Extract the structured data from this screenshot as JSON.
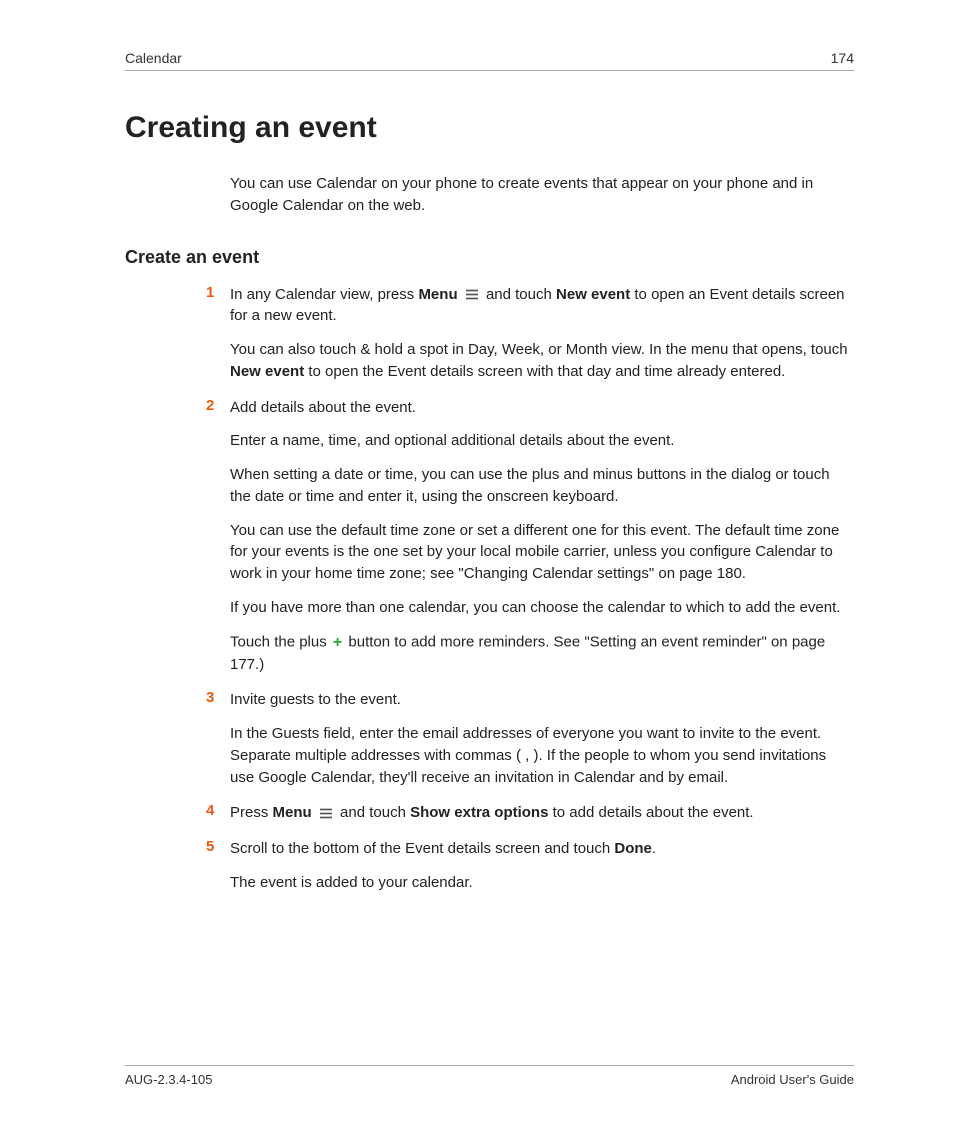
{
  "header": {
    "section": "Calendar",
    "page_number": "174"
  },
  "title": "Creating an event",
  "intro": "You can use Calendar on your phone to create events that appear on your phone and in Google Calendar on the web.",
  "subhead": "Create an event",
  "steps": {
    "s1": {
      "num": "1",
      "p1a": "In any Calendar view, press ",
      "p1b": "Menu",
      "p1c": " and touch ",
      "p1d": "New event",
      "p1e": " to open an Event details screen for a new event.",
      "p2a": "You can also touch & hold a spot in Day, Week, or Month view. In the menu that opens, touch ",
      "p2b": "New event",
      "p2c": " to open the Event details screen with that day and time already entered."
    },
    "s2": {
      "num": "2",
      "p1": "Add details about the event.",
      "p2": "Enter a name, time, and optional additional details about the event.",
      "p3": "When setting a date or time, you can use the plus and minus buttons in the dialog or touch the date or time and enter it, using the onscreen keyboard.",
      "p4": "You can use the default time zone or set a different one for this event. The default time zone for your events is the one set by your local mobile carrier, unless you configure Calendar to work in your home time zone; see \"Changing Calendar settings\" on page 180.",
      "p5": "If you have more than one calendar, you can choose the calendar to which to add the event.",
      "p6a": "Touch the plus ",
      "p6b": " button to add more reminders. See \"Setting an event reminder\" on page 177.)"
    },
    "s3": {
      "num": "3",
      "p1": "Invite guests to the event.",
      "p2": "In the Guests field, enter the email addresses of everyone you want to invite to the event. Separate multiple addresses with commas ( , ). If the people to whom you send invitations use Google Calendar, they'll receive an invitation in Calendar and by email."
    },
    "s4": {
      "num": "4",
      "p1a": "Press ",
      "p1b": "Menu",
      "p1c": " and touch ",
      "p1d": "Show extra options",
      "p1e": " to add details about the event."
    },
    "s5": {
      "num": "5",
      "p1a": "Scroll to the bottom of the Event details screen and touch ",
      "p1b": "Done",
      "p1c": ".",
      "p2": "The event is added to your calendar."
    }
  },
  "footer": {
    "left": "AUG-2.3.4-105",
    "right": "Android User's Guide"
  },
  "icons": {
    "plus": "+"
  }
}
